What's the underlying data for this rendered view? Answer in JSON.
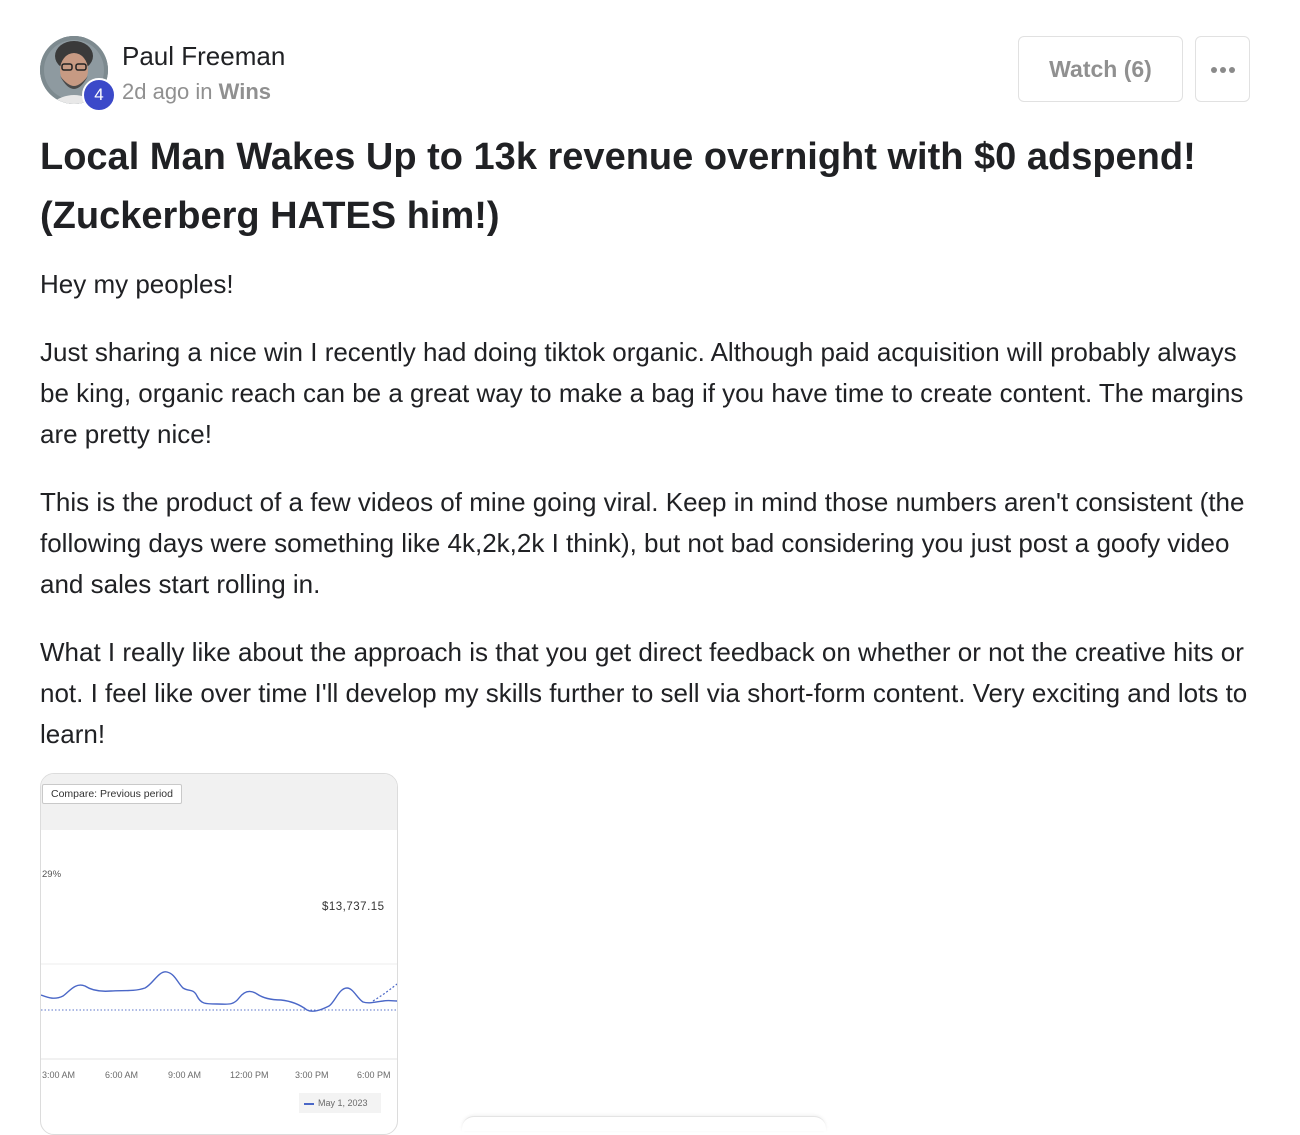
{
  "post": {
    "author": {
      "name": "Paul Freeman",
      "level": "4"
    },
    "meta": {
      "time": "2d ago",
      "in_word": "in",
      "category": "Wins"
    },
    "actions": {
      "watch_label": "Watch (6)",
      "more_icon": "more-horizontal-icon"
    },
    "title": "Local Man Wakes Up to 13k revenue overnight with $0 adspend! (Zuckerberg HATES him!)",
    "paragraphs": [
      "Hey my peoples!",
      "Just sharing a nice win I recently had doing tiktok organic. Although paid acquisition will probably always be king, organic reach can be a great way to make a bag if you have time to create content. The margins are pretty nice!",
      "This is the product of a few videos of mine going viral. Keep in mind those numbers aren't consistent (the following days were something like 4k,2k,2k I think), but not bad considering you just post a goofy video and sales start rolling in.",
      "What I really like about the approach is that you get direct feedback on whether or not the creative hits or not. I feel like over time I'll develop my skills further to sell via short-form content. Very exciting and lots to learn!"
    ]
  },
  "attachment": {
    "compare_label": "Compare: Previous period",
    "percent_label": "29%",
    "total_value": "$13,737.15",
    "chart_data": {
      "type": "line",
      "x": [
        "3:00 AM",
        "6:00 AM",
        "9:00 AM",
        "12:00 PM",
        "3:00 PM",
        "6:00 PM"
      ],
      "tick_labels": [
        "3:00 AM",
        "6:00 AM",
        "9:00 AM",
        "12:00 PM",
        "3:00 PM",
        "6:00 PM"
      ],
      "series": [
        {
          "name": "May 1, 2023",
          "style": "solid",
          "color": "#4a67c7"
        },
        {
          "style": "dotted",
          "color": "#4a67c7"
        }
      ],
      "legend_placement": "bottom-right",
      "legend": [
        "May 1, 2023"
      ]
    }
  },
  "colors": {
    "text": "#202124",
    "muted": "#909090",
    "badge": "#3b49c9",
    "border": "#e1e1e1",
    "chart_line": "#4a67c7"
  }
}
